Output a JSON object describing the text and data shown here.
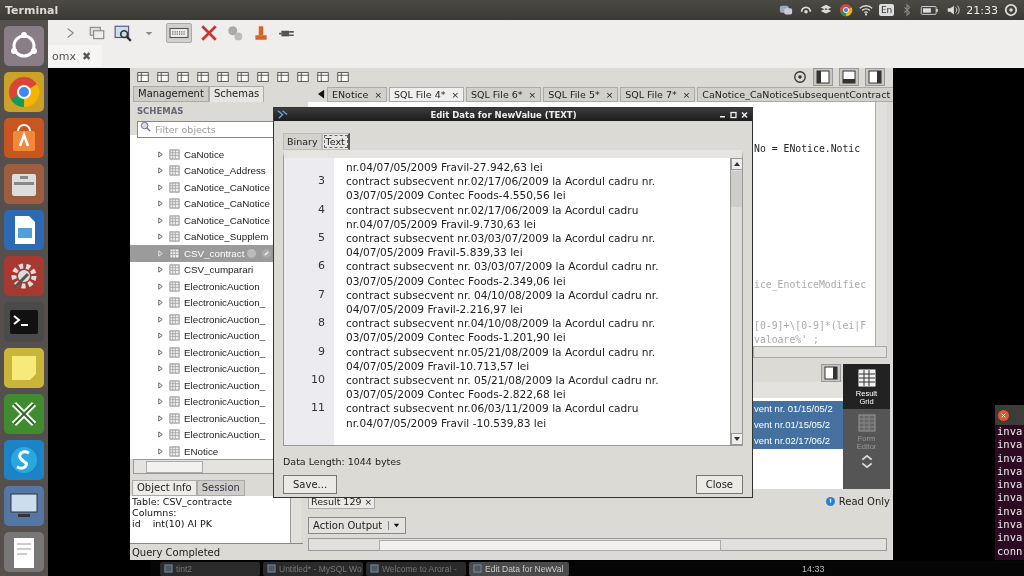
{
  "top_bar": {
    "title": "Terminal",
    "keyboard": "En",
    "clock": "21:33"
  },
  "back_window": {
    "tab": "omx",
    "tab_close": "✖"
  },
  "workbench": {
    "sidebar_tabs": [
      {
        "label": "Management",
        "selected": false
      },
      {
        "label": "Schemas",
        "selected": true
      }
    ],
    "schemas_heading": "SCHEMAS",
    "filter": {
      "placeholder": "Filter objects"
    },
    "tables": [
      {
        "name": "CaNotice",
        "selected": false
      },
      {
        "name": "CaNotice_Address",
        "selected": false
      },
      {
        "name": "CaNotice_CaNotice",
        "selected": false
      },
      {
        "name": "CaNotice_CaNotice",
        "selected": false
      },
      {
        "name": "CaNotice_CaNotice",
        "selected": false
      },
      {
        "name": "CaNotice_Supplem",
        "selected": false
      },
      {
        "name": "CSV_contract",
        "selected": true
      },
      {
        "name": "CSV_cumparari",
        "selected": false
      },
      {
        "name": "ElectronicAuction",
        "selected": false
      },
      {
        "name": "ElectronicAuction_",
        "selected": false
      },
      {
        "name": "ElectronicAuction_",
        "selected": false
      },
      {
        "name": "ElectronicAuction_",
        "selected": false
      },
      {
        "name": "ElectronicAuction_",
        "selected": false
      },
      {
        "name": "ElectronicAuction_",
        "selected": false
      },
      {
        "name": "ElectronicAuction_",
        "selected": false
      },
      {
        "name": "ElectronicAuction_",
        "selected": false
      },
      {
        "name": "ElectronicAuction_",
        "selected": false
      },
      {
        "name": "ElectronicAuction_",
        "selected": false
      },
      {
        "name": "ENotice",
        "selected": false
      }
    ],
    "info_tabs": [
      {
        "label": "Object Info",
        "selected": true
      },
      {
        "label": "Session",
        "selected": false
      }
    ],
    "object_info": {
      "table": "Table: CSV_contracte",
      "columns": "Columns:",
      "column_name": "id",
      "column_type": "int(10) AI PK"
    },
    "editor_tabs": [
      {
        "label": "ENotice",
        "selected": false
      },
      {
        "label": "SQL File 4*",
        "selected": true
      },
      {
        "label": "SQL File 6*",
        "selected": false
      },
      {
        "label": "SQL File 5*",
        "selected": false
      },
      {
        "label": "SQL File 7*",
        "selected": false
      },
      {
        "label": "CaNotice_CaNoticeSubsequentContract",
        "selected": false
      }
    ],
    "tab_close": "×",
    "code_lines": [
      "No =  ENotice.Notic",
      "ice_EnoticeModifiec",
      "[0-9]+\\[0-9]*(lei|F",
      "valoare%' ;"
    ],
    "result_rows": [
      "vent nr. 01/15/05/2",
      "vent nr.01/15/05/2",
      "vent nr.02/17/06/2"
    ],
    "side_panel": [
      {
        "label": "Result Grid",
        "selected": true
      },
      {
        "label": "Form Editor",
        "selected": false
      }
    ],
    "result_tab": "Result 129",
    "read_only": "Read Only",
    "output_select": "Action Output",
    "status": "Query Completed"
  },
  "dialog": {
    "title": "Edit Data for NewValue (TEXT)",
    "tabs": [
      {
        "label": "Binary",
        "selected": false
      },
      {
        "label": "Text",
        "selected": true
      }
    ],
    "entries": [
      {
        "lines": [
          "nr.04/07/05/2009 Fravil-27.942,63 lei"
        ]
      },
      {
        "number": "3",
        "lines": [
          "contract subsecvent nr.02/17/06/2009 la Acordul cadru nr.",
          "03/07/05/2009 Contec Foods-4.550,56 lei"
        ]
      },
      {
        "number": "4",
        "lines": [
          "contract subsecvent nr.02/17/06/2009 la Acordul cadru",
          "nr.04/07/05/2009 Fravil-9.730,63 lei"
        ]
      },
      {
        "number": "5",
        "lines": [
          "contract subsecvent nr.03/03/07/2009 la Acordul cadru nr.",
          "04/07/05/2009 Fravil-5.839,33 lei"
        ]
      },
      {
        "number": "6",
        "lines": [
          "contract subsecvent nr. 03/03/07/2009 la Acordul cadru nr.",
          "03/07/05/2009 Contec Foods-2.349,06 lei"
        ]
      },
      {
        "number": "7",
        "lines": [
          "contract subsecvent nr. 04/10/08/2009 la Acordul cadru nr.",
          "04/07/05/2009 Fravil-2.216,97 lei"
        ]
      },
      {
        "number": "8",
        "lines": [
          "contract subsecvent nr.04/10/08/2009 la Acordul cadru nr.",
          "03/07/05/2009 Contec Foods-1.201,90 lei"
        ]
      },
      {
        "number": "9",
        "lines": [
          "contract subsecvent nr.05/21/08/2009 la Acordul cadru nr.",
          "04/07/05/2009 Fravil-10.713,57 lei"
        ]
      },
      {
        "number": "10",
        "lines": [
          "contract subsecvent nr. 05/21/08/2009 la Acordul cadru nr.",
          "03/07/05/2009 Contec Foods-2.822,68 lei"
        ]
      },
      {
        "number": "11",
        "lines": [
          "contract subsecvent nr.06/03/11/2009 la Acordul cadru",
          "nr.04/07/05/2009 Fravil -10.539,83 lei"
        ]
      }
    ],
    "data_length": "Data Length: 1044 bytes",
    "buttons": [
      "Save...",
      "Close"
    ]
  },
  "terminal": {
    "lines": [
      "inva",
      "inva",
      "inva",
      "inva",
      "inva",
      "inva",
      "inva",
      "inva",
      "inva",
      "conn"
    ]
  },
  "taskbar": {
    "items": [
      {
        "label": "tint2",
        "selected": false
      },
      {
        "label": "Untitled* - MySQL Wo",
        "selected": false
      },
      {
        "label": "Welcome to Arora! -",
        "selected": false
      },
      {
        "label": "Edit Data for NewVal",
        "selected": true
      }
    ],
    "clock": "14:33"
  }
}
